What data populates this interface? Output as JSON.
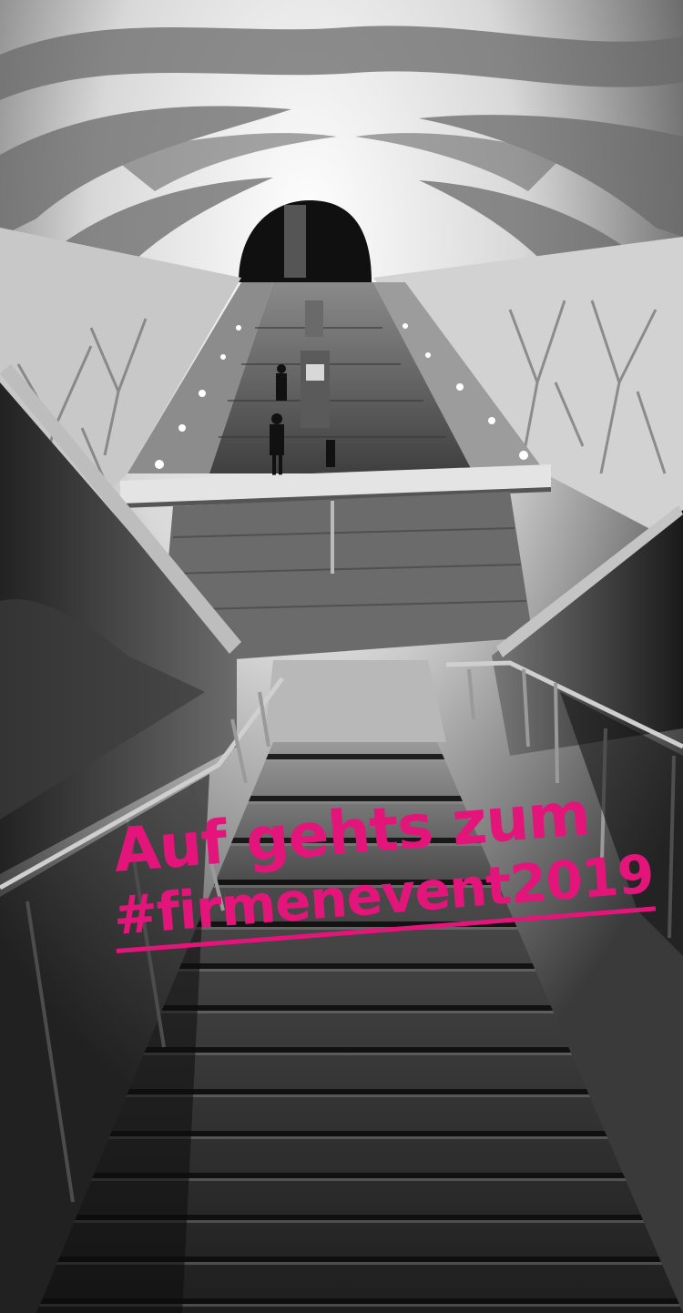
{
  "story": {
    "caption_line1": "Auf gehts zum",
    "caption_line2": "#firmenevent2019",
    "caption_color": "#e3157a"
  }
}
